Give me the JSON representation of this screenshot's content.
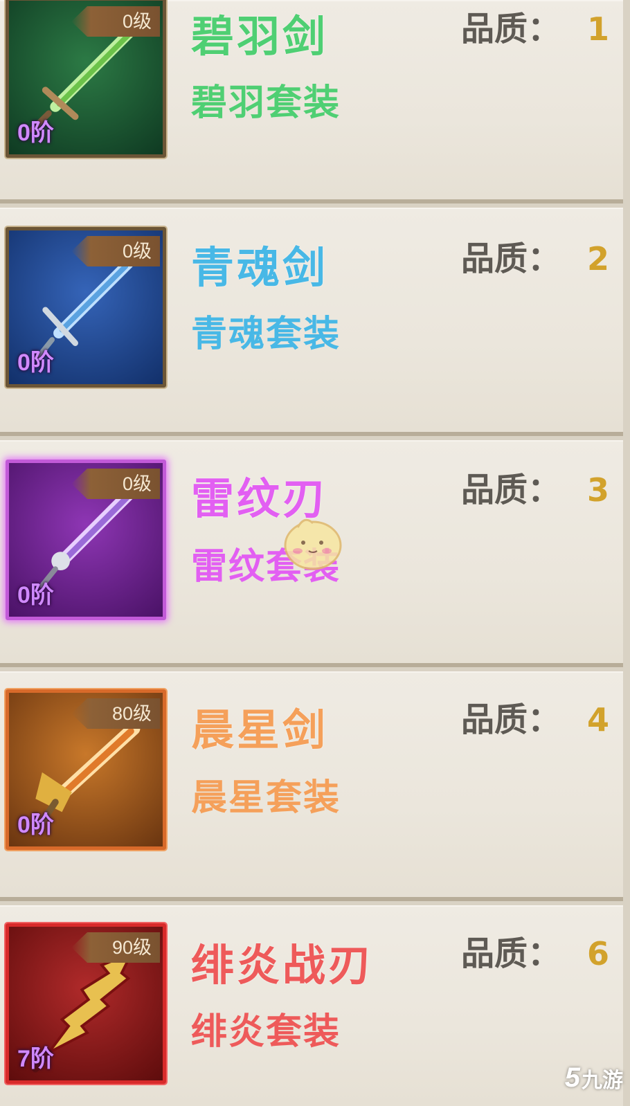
{
  "items": [
    {
      "name": "碧羽剑",
      "set": "碧羽套装",
      "level_tag": "0级",
      "stage": "0阶",
      "quality_label": "品质：",
      "quality_value": "1",
      "name_color": "#4fcf73",
      "frame_bg": [
        "#1f5a33",
        "#0f3a22"
      ],
      "icon": "green-sword-icon"
    },
    {
      "name": "青魂剑",
      "set": "青魂套装",
      "level_tag": "0级",
      "stage": "0阶",
      "quality_label": "品质：",
      "quality_value": "2",
      "name_color": "#48b8e6",
      "frame_bg": [
        "#2852a0",
        "#12306a"
      ],
      "icon": "blue-sword-icon"
    },
    {
      "name": "雷纹刃",
      "set": "雷纹套装",
      "level_tag": "0级",
      "stage": "0阶",
      "quality_label": "品质：",
      "quality_value": "3",
      "name_color": "#e25ff2",
      "frame_bg": [
        "#7e2aa0",
        "#4a1266"
      ],
      "icon": "purple-blade-icon"
    },
    {
      "name": "晨星剑",
      "set": "晨星套装",
      "level_tag": "80级",
      "stage": "0阶",
      "quality_label": "品质：",
      "quality_value": "4",
      "name_color": "#f5a05a",
      "frame_bg": [
        "#b86a22",
        "#6a3510"
      ],
      "icon": "orange-sword-icon"
    },
    {
      "name": "绯炎战刃",
      "set": "绯炎套装",
      "level_tag": "90级",
      "stage": "7阶",
      "quality_label": "品质：",
      "quality_value": "6",
      "name_color": "#ee5a5a",
      "frame_bg": [
        "#a82222",
        "#5e0c0c"
      ],
      "icon": "red-flame-blade-icon"
    }
  ],
  "watermark": {
    "glyph": "5",
    "text": "九游"
  }
}
